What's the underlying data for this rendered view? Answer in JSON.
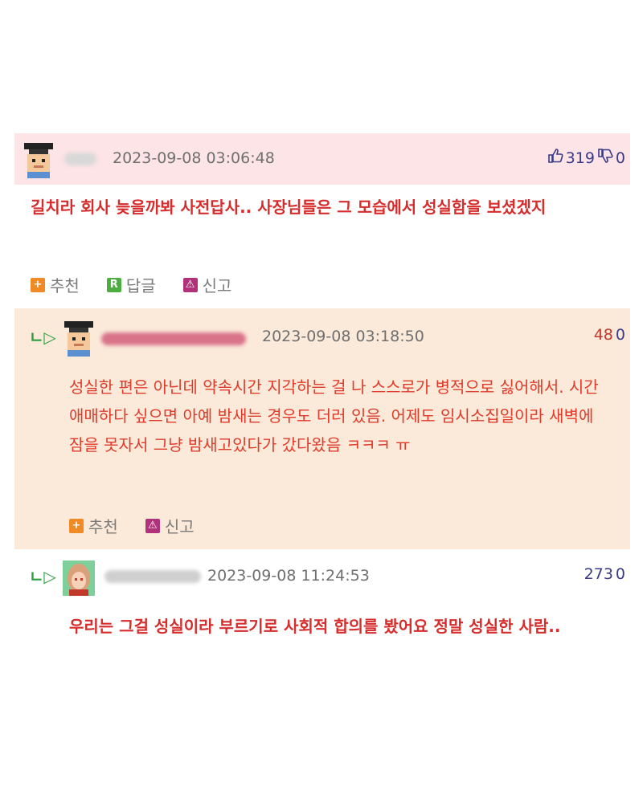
{
  "comments": [
    {
      "date": "2023-09-08 03:06:48",
      "up": "319",
      "down": "0",
      "text": "길치라 회사 늦을까봐 사전답사.. 사장님들은 그 모습에서 성실함을 보셨겠지",
      "actions": {
        "recommend": "추천",
        "reply": "답글",
        "report": "신고"
      }
    },
    {
      "date": "2023-09-08 03:18:50",
      "up": "48",
      "down": "0",
      "text": "성실한 편은 아닌데 약속시간 지각하는 걸 나 스스로가 병적으로 싫어해서. 시간 애매하다 싶으면 아예 밤새는 경우도 더러 있음. 어제도 임시소집일이라 새벽에 잠을 못자서 그냥 밤새고있다가 갔다왔음 ㅋㅋㅋ ㅠ",
      "actions": {
        "recommend": "추천",
        "report": "신고"
      }
    },
    {
      "date": "2023-09-08 11:24:53",
      "up": "273",
      "down": "0",
      "text": "우리는 그걸 성실이라 부르기로 사회적 합의를 봤어요 정말 성실한 사람.."
    }
  ],
  "icons": {
    "reply_arrow": "ㄴ▷",
    "thumb_up": "👍",
    "thumb_down": "👎",
    "recommend_glyph": "+",
    "reply_glyph": "R",
    "report_glyph": "⚠"
  }
}
